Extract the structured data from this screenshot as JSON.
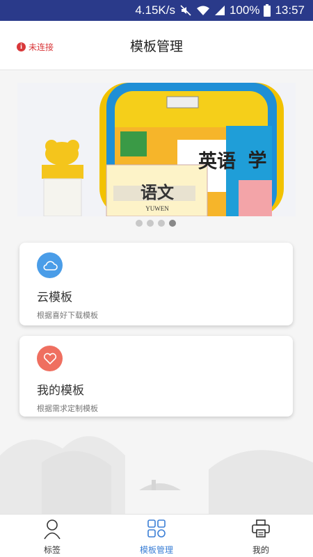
{
  "status_bar": {
    "speed": "4.15K/s",
    "battery": "100%",
    "time": "13:57",
    "icons": [
      "mute-icon",
      "wifi-icon",
      "signal-icon",
      "battery-icon"
    ]
  },
  "header": {
    "connection_status": "未连接",
    "title": "模板管理"
  },
  "banner": {
    "book_labels": [
      "英语",
      "学",
      "语文",
      "YUWEN"
    ],
    "dots_count": 4,
    "active_dot": 3
  },
  "cards": [
    {
      "icon": "cloud-icon",
      "title": "云模板",
      "subtitle": "根据喜好下载模板",
      "color": "#4a9de8"
    },
    {
      "icon": "heart-icon",
      "title": "我的模板",
      "subtitle": "根据需求定制模板",
      "color": "#ef6f60"
    }
  ],
  "bottom_nav": [
    {
      "icon": "person-icon",
      "label": "标签"
    },
    {
      "icon": "grid-icon",
      "label": "模板管理",
      "active": true
    },
    {
      "icon": "printer-icon",
      "label": "我的"
    }
  ],
  "colors": {
    "status_bar": "#2a3a8a",
    "accent": "#3b7fd6",
    "error": "#d9383a"
  }
}
